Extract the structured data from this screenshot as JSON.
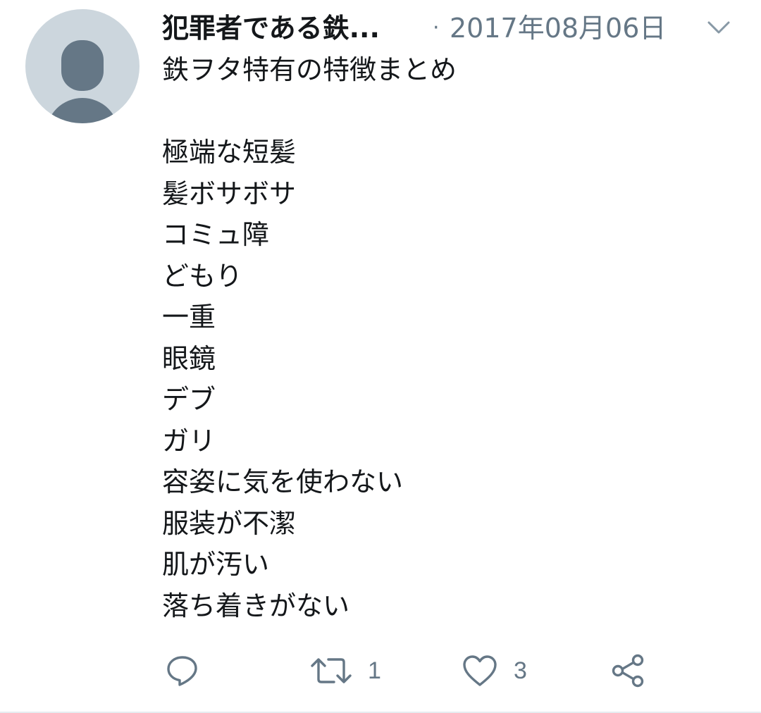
{
  "tweet": {
    "display_name": "犯罪者である鉄...",
    "separator": "·",
    "timestamp": "2017年08月06日",
    "text_lines": [
      "鉄ヲタ特有の特徴まとめ",
      "",
      "極端な短髪",
      "髪ボサボサ",
      "コミュ障",
      "どもり",
      "一重",
      "眼鏡",
      "デブ",
      "ガリ",
      "容姿に気を使わない",
      "服装が不潔",
      "肌が汚い",
      "落ち着きがない"
    ],
    "actions": {
      "reply_icon": "reply-icon",
      "retweet_icon": "retweet-icon",
      "retweet_count": "1",
      "like_icon": "heart-icon",
      "like_count": "3",
      "share_icon": "share-icon"
    }
  },
  "colors": {
    "text": "#14171a",
    "secondary": "#657786",
    "avatar_bg": "#ccd6dd",
    "divider": "#e6ecf0"
  }
}
